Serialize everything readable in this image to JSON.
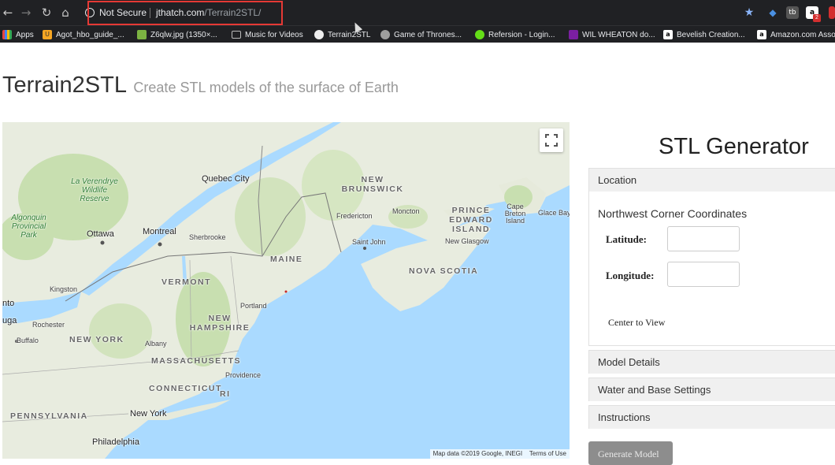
{
  "browser": {
    "security_label": "Not Secure",
    "url_host": "jthatch.com",
    "url_path": "/Terrain2STL/",
    "bookmarks": [
      {
        "label": "Apps",
        "icon": "apps-grid-icon"
      },
      {
        "label": "Agot_hbo_guide_...",
        "icon": "bookmark-favicon-icon"
      },
      {
        "label": "Z6qlw.jpg (1350×...",
        "icon": "image-favicon-icon"
      },
      {
        "label": "Music for Videos",
        "icon": "folder-icon"
      },
      {
        "label": "Terrain2STL",
        "icon": "globe-favicon-icon"
      },
      {
        "label": "Game of Thrones...",
        "icon": "globe-favicon-icon"
      },
      {
        "label": "Refersion - Login...",
        "icon": "leaf-favicon-icon"
      },
      {
        "label": "WIL WHEATON do...",
        "icon": "pixel-favicon-icon"
      },
      {
        "label": "Bevelish Creation...",
        "icon": "amazon-favicon-icon"
      },
      {
        "label": "Amazon.com Asso",
        "icon": "amazon-favicon-icon"
      }
    ],
    "extension_badge": "2"
  },
  "page": {
    "title": "Terrain2STL",
    "subtitle": "Create STL models of the surface of Earth"
  },
  "map": {
    "attribution": "Map data ©2019 Google, INEGI",
    "terms": "Terms of Use",
    "labels": {
      "quebec_city": "Quebec City",
      "new_brunswick": "NEW BRUNSWICK",
      "la_verendrye": "La Verendrye Wildlife Reserve",
      "fredericton": "Fredericton",
      "moncton": "Moncton",
      "pei": "PRINCE EDWARD ISLAND",
      "cape_breton": "Cape Breton Island",
      "glace_bay": "Glace Bay",
      "algonquin": "Algonquin Provincial Park",
      "ottawa": "Ottawa",
      "montreal": "Montreal",
      "sherbrooke": "Sherbrooke",
      "saint_john": "Saint John",
      "new_glasgow": "New Glasgow",
      "maine": "MAINE",
      "nova_scotia": "NOVA SCOTIA",
      "vermont": "VERMONT",
      "kingston": "Kingston",
      "portland": "Portland",
      "toronto": "nto",
      "niagara": "uga",
      "rochester": "Rochester",
      "new_hampshire": "NEW HAMPSHIRE",
      "buffalo": "Buffalo",
      "new_york_state": "NEW YORK",
      "albany": "Albany",
      "massachusetts": "MASSACHUSETTS",
      "providence": "Providence",
      "connecticut": "CONNECTICUT",
      "rhode_island": "RI",
      "pennsylvania": "PENNSYLVANIA",
      "new_york_city": "New York",
      "philadelphia": "Philadelphia"
    }
  },
  "generator": {
    "heading": "STL Generator",
    "sections": {
      "location": "Location",
      "model_details": "Model Details",
      "water_base": "Water and Base Settings",
      "instructions": "Instructions"
    },
    "coord_title": "Northwest Corner Coordinates",
    "latitude_label": "Latitude:",
    "latitude_value": "",
    "longitude_label": "Longitude:",
    "longitude_value": "",
    "center_link": "Center to View",
    "generate_button": "Generate Model"
  },
  "colors": {
    "water": "#aadaff",
    "land": "#e8ecdf",
    "forest": "#c8dfb0",
    "highlight_box": "#e53935",
    "button_gray": "#8d8d8d"
  }
}
